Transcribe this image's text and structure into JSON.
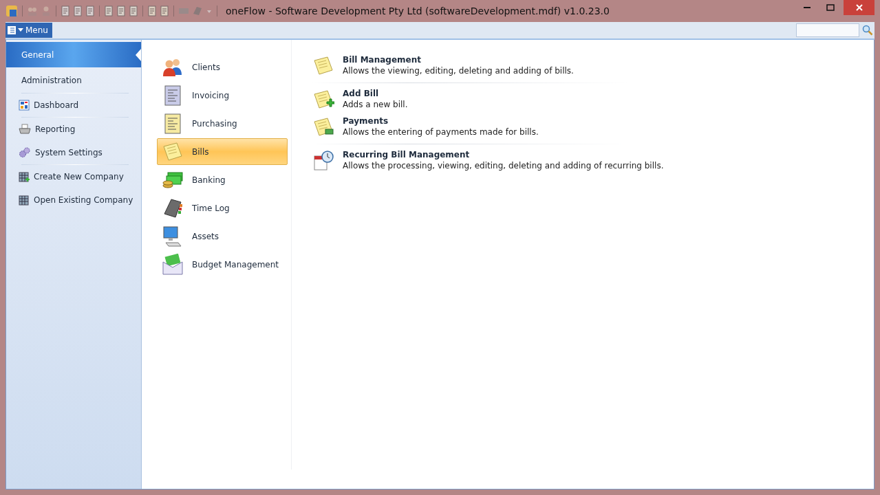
{
  "window": {
    "title": "oneFlow - Software Development Pty Ltd (softwareDevelopment.mdf) v1.0.23.0"
  },
  "menu_button": {
    "label": "Menu"
  },
  "sidebar": {
    "items": [
      {
        "label": "General",
        "kind": "section",
        "selected": true
      },
      {
        "label": "Administration",
        "kind": "section",
        "selected": false
      },
      {
        "label": "Dashboard",
        "kind": "command",
        "selected": false
      },
      {
        "label": "Reporting",
        "kind": "command",
        "selected": false
      },
      {
        "label": "System Settings",
        "kind": "command",
        "selected": false
      },
      {
        "label": "Create New Company",
        "kind": "command",
        "selected": false
      },
      {
        "label": "Open Existing Company",
        "kind": "command",
        "selected": false
      }
    ]
  },
  "categories": [
    {
      "label": "Clients",
      "selected": false
    },
    {
      "label": "Invoicing",
      "selected": false
    },
    {
      "label": "Purchasing",
      "selected": false
    },
    {
      "label": "Bills",
      "selected": true
    },
    {
      "label": "Banking",
      "selected": false
    },
    {
      "label": "Time Log",
      "selected": false
    },
    {
      "label": "Assets",
      "selected": false
    },
    {
      "label": "Budget Management",
      "selected": false
    }
  ],
  "actions": [
    {
      "title": "Bill Management",
      "description": "Allows the viewing, editing, deleting and adding of bills."
    },
    {
      "title": "Add Bill",
      "description": "Adds a new bill."
    },
    {
      "title": "Payments",
      "description": "Allows the entering of payments made for bills."
    },
    {
      "title": "Recurring Bill Management",
      "description": "Allows the processing, viewing, editing, deleting and adding of recurring bills."
    }
  ]
}
